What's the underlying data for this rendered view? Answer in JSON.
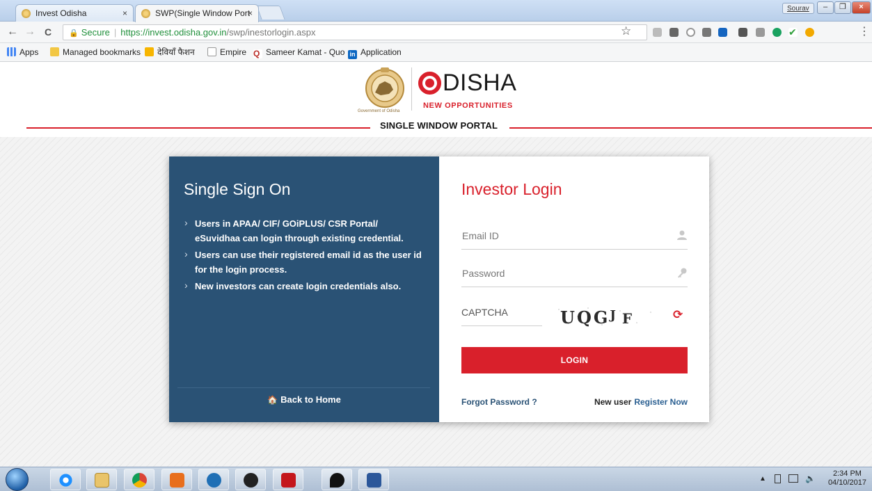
{
  "browser": {
    "tabs": [
      {
        "title": "Invest Odisha",
        "close": "×"
      },
      {
        "title": "SWP(Single Window Port",
        "close": "×"
      }
    ],
    "user_badge": "Sourav",
    "window_buttons": {
      "minimize": "–",
      "maximize": "❐",
      "close": "×"
    },
    "nav": {
      "back": "←",
      "forward": "→",
      "reload": "C"
    },
    "address": {
      "secure_label": "Secure",
      "scheme_host": "https://invest.odisha.gov.in",
      "path": "/swp/inestorlogin.aspx"
    },
    "star": "☆",
    "menu": "⋮",
    "bookmarks": [
      {
        "label": "Apps",
        "icon": "apps-grid-icon",
        "color": "#4285f4"
      },
      {
        "label": "Managed bookmarks",
        "icon": "folder-icon",
        "color": "#f2c744"
      },
      {
        "label": "देवियाँ फैशन",
        "icon": "bookmark-favicon-icon",
        "color": "#f7b500"
      },
      {
        "label": "Empire",
        "icon": "page-icon",
        "color": "#999999"
      },
      {
        "label": "Sameer Kamat - Quo",
        "icon": "quora-icon",
        "color": "#b92b27"
      },
      {
        "label": "Application",
        "icon": "linkedin-icon",
        "color": "#0a66c2"
      }
    ]
  },
  "header": {
    "emblem_caption": "Government of Odisha",
    "logo_word": "DISHA",
    "tagline": "NEW OPPORTUNITIES",
    "portal_title": "SINGLE WINDOW PORTAL"
  },
  "sso": {
    "title": "Single Sign On",
    "bullets": [
      "Users in APAA/ CIF/ GOiPLUS/ CSR Portal/ eSuvidhaa can login through existing credential.",
      "Users can use their registered email id as the user id for the login process.",
      "New investors can create login credentials also."
    ],
    "back_home": "Back to Home"
  },
  "login": {
    "title": "Investor Login",
    "email_placeholder": "Email ID",
    "password_placeholder": "Password",
    "captcha_placeholder": "CAPTCHA",
    "captcha_text": "UQGJF",
    "login_button": "LOGIN",
    "forgot": "Forgot Password ?",
    "new_user": "New user",
    "register": "Register Now"
  },
  "colors": {
    "brand_red": "#d9202b",
    "panel_blue": "#2a5275"
  },
  "taskbar": {
    "apps": [
      "internet-explorer-icon",
      "file-explorer-icon",
      "chrome-icon",
      "outlook-icon",
      "network-icon",
      "app-p-icon",
      "acrobat-icon",
      "maps-pin-icon",
      "word-icon"
    ],
    "clock_time": "2:34 PM",
    "clock_date": "04/10/2017"
  }
}
